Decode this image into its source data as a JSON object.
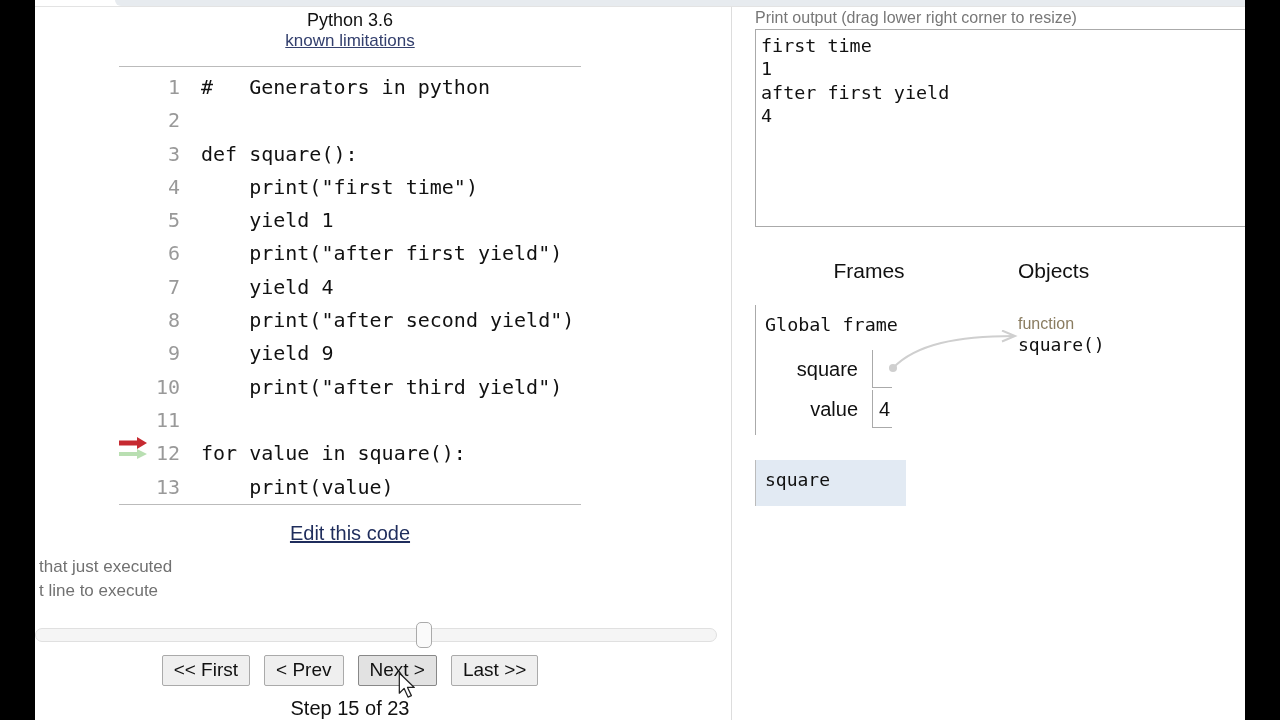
{
  "header": {
    "title": "Python 3.6",
    "link": "known limitations"
  },
  "code": {
    "lines": [
      {
        "number": "1",
        "text": "#   Generators in python",
        "just_executed": false,
        "next": false
      },
      {
        "number": "2",
        "just_executed": false,
        "next": false
      },
      {
        "number": "3",
        "text": "def square():",
        "just_executed": false,
        "next": false
      },
      {
        "number": "4",
        "text": "    print(\"first time\")",
        "just_executed": false,
        "next": false
      },
      {
        "number": "5",
        "text": "    yield 1",
        "just_executed": false,
        "next": false
      },
      {
        "number": "6",
        "text": "    print(\"after first yield\")",
        "just_executed": false,
        "next": false
      },
      {
        "number": "7",
        "text": "    yield 4",
        "just_executed": false,
        "next": false
      },
      {
        "number": "8",
        "text": "    print(\"after second yield\")",
        "just_executed": false,
        "next": false
      },
      {
        "number": "9",
        "text": "    yield 9",
        "just_executed": false,
        "next": false
      },
      {
        "number": "10",
        "text": "    print(\"after third yield\")",
        "just_executed": false,
        "next": false
      },
      {
        "number": "11",
        "just_executed": false,
        "next": false
      },
      {
        "number": "12",
        "text": "for value in square():",
        "just_executed": true,
        "next": true
      },
      {
        "number": "13",
        "text": "    print(value)",
        "just_executed": false,
        "next": false
      }
    ]
  },
  "edit_link": "Edit this code",
  "legend": [
    "that just executed",
    "t line to execute"
  ],
  "slider": {
    "level": 0.57
  },
  "buttons": [
    {
      "label": "<< First",
      "hovered": false
    },
    {
      "label": "< Prev",
      "hovered": false
    },
    {
      "label": "Next >",
      "hovered": true
    },
    {
      "label": "Last >>",
      "hovered": false
    }
  ],
  "step_label": "Step 15 of 23",
  "print_output": {
    "label": "Print output (drag lower right corner to resize)",
    "lines": [
      "first time",
      "1",
      "after first yield",
      "4"
    ]
  },
  "frames": {
    "heading": "Frames",
    "global_frame": {
      "title": "Global frame",
      "variables": [
        {
          "name": "square",
          "kind": "pointer"
        },
        {
          "name": "value",
          "kind": "value",
          "value": "4"
        }
      ]
    },
    "stack": [
      {
        "name": "square",
        "highlighted": true
      }
    ]
  },
  "objects": {
    "heading": "Objects",
    "items": [
      {
        "type_label": "function",
        "name": "square()"
      }
    ]
  }
}
